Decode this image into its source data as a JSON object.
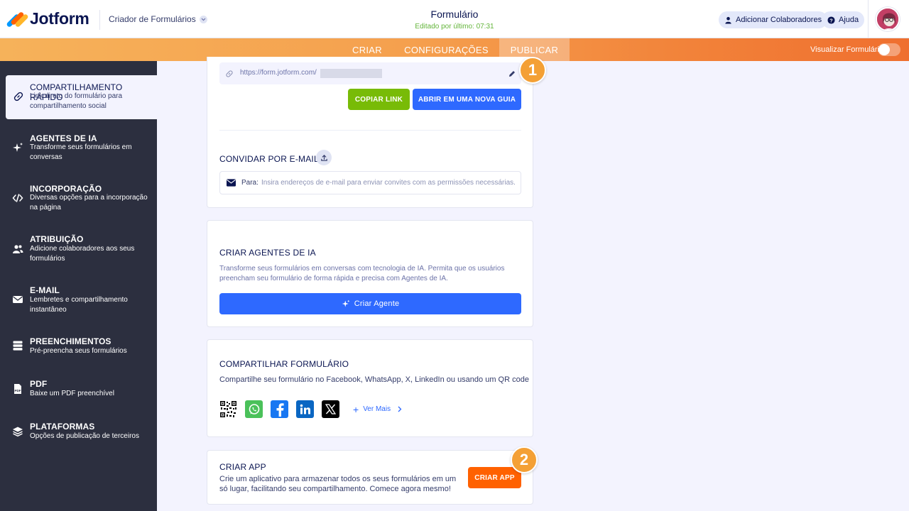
{
  "header": {
    "logo_text": "Jotform",
    "builder_label": "Criador de Formulários",
    "form_title": "Formulário",
    "last_edited": "Editado por último: 07:31",
    "collaborators_label": "Adicionar Colaboradores",
    "help_label": "Ajuda"
  },
  "nav": {
    "tabs": [
      {
        "label": "CRIAR"
      },
      {
        "label": "CONFIGURAÇÕES"
      },
      {
        "label": "PUBLICAR"
      }
    ],
    "active_tab": "PUBLICAR",
    "preview_label": "Visualizar Formulário"
  },
  "sidebar": {
    "items": [
      {
        "title": "COMPARTILHAMENTO RÁPIDO",
        "desc": "Link direto do formulário para compartilhamento social",
        "icon": "link-icon"
      },
      {
        "title": "AGENTES DE IA",
        "desc": "Transforme seus formulários em conversas",
        "icon": "sparkle-icon"
      },
      {
        "title": "INCORPORAÇÃO",
        "desc": "Diversas opções para a incorporação na página",
        "icon": "code-icon"
      },
      {
        "title": "ATRIBUIÇÃO",
        "desc": "Adicione colaboradores aos seus formulários",
        "icon": "users-icon"
      },
      {
        "title": "E-MAIL",
        "desc": "Lembretes e compartilhamento instantâneo",
        "icon": "envelope-icon"
      },
      {
        "title": "PREENCHIMENTOS",
        "desc": "Pré-preencha seus formulários",
        "icon": "database-icon"
      },
      {
        "title": "PDF",
        "desc": "Baixe um PDF preenchível",
        "icon": "pdf-icon"
      },
      {
        "title": "PLATAFORMAS",
        "desc": "Opções de publicação de terceiros",
        "icon": "layers-icon"
      }
    ]
  },
  "quick_share": {
    "url": "https://form.jotform.com/",
    "copy_label": "COPIAR LINK",
    "open_label": "ABRIR EM UMA NOVA GUIA",
    "invite_title": "CONVIDAR POR E-MAIL",
    "to_label": "Para:",
    "email_placeholder": "Insira endereços de e-mail para enviar convites com as permissões necessárias."
  },
  "ai_agents": {
    "title": "CRIAR AGENTES DE IA",
    "desc": "Transforme seus formulários em conversas com tecnologia de IA. Permita que os usuários preencham seu formulário de forma rápida e precisa com Agentes de IA.",
    "button_label": "Criar Agente"
  },
  "share_form": {
    "title": "COMPARTILHAR FORMULÁRIO",
    "desc": "Compartilhe seu formulário no Facebook, WhatsApp, X, LinkedIn ou usando um QR code",
    "more_label": "Ver Mais",
    "icons": [
      "qr-code-icon",
      "whatsapp-icon",
      "facebook-icon",
      "linkedin-icon",
      "x-icon"
    ]
  },
  "create_app": {
    "title": "CRIAR APP",
    "desc": "Crie um aplicativo para armazenar todos os seus formulários em um só lugar, facilitando seu compartilhamento. Comece agora mesmo!",
    "button_label": "CRIAR APP"
  },
  "markers": [
    "1",
    "2"
  ],
  "colors": {
    "green": "#78bb07",
    "blue": "#2e69ff",
    "orange": "#ff6100",
    "sidebar": "#2c2f3f",
    "marker": "#f4a035"
  }
}
